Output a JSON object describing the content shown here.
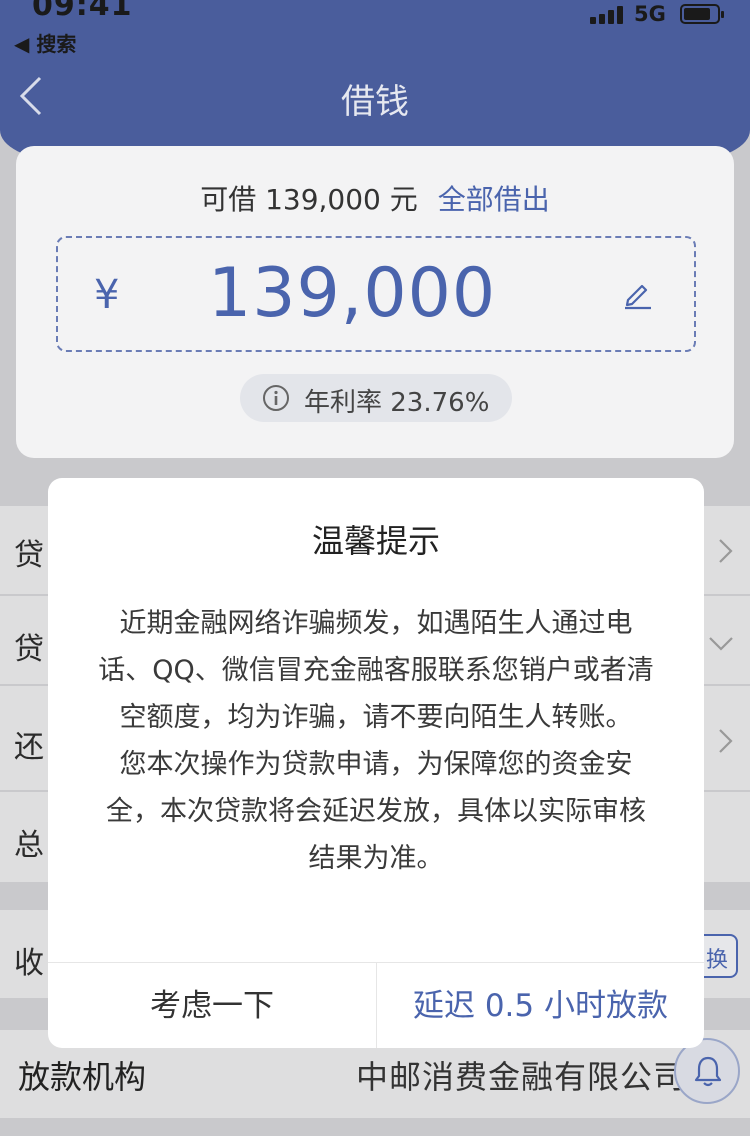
{
  "status_bar": {
    "time": "09:41",
    "back_app": "◀ 搜索",
    "network": "5G"
  },
  "nav": {
    "title": "借钱"
  },
  "card": {
    "available_label": "可借 139,000 元",
    "borrow_all_link": "全部借出",
    "currency_symbol": "¥",
    "amount": "139,000",
    "rate_text": "年利率 23.76%"
  },
  "rows": [
    {
      "label": "贷",
      "chevron": "right"
    },
    {
      "label": "贷",
      "chevron": "down"
    },
    {
      "label": "还",
      "chevron": "right"
    },
    {
      "label": "总",
      "chevron": "none"
    },
    {
      "label": "收",
      "chevron": "none"
    }
  ],
  "change_button": {
    "label": "换"
  },
  "lender": {
    "label": "放款机构",
    "value": "中邮消费金融有限公司"
  },
  "dialog": {
    "title": "温馨提示",
    "lines": [
      "近期金融网络诈骗频发，如遇陌生人通过电",
      "话、QQ、微信冒充金融客服联系您销户或者清",
      "空额度，均为诈骗，请不要向陌生人转账。",
      "您本次操作为贷款申请，为保障您的资金安",
      "全，本次贷款将会延迟发放，具体以实际审核",
      "结果为准。"
    ],
    "cancel_label": "考虑一下",
    "confirm_label": "延迟 0.5 小时放款"
  },
  "colors": {
    "accent": "#4a64ad",
    "header": "#4a5d9c",
    "overlay": "#c9c9cc"
  }
}
